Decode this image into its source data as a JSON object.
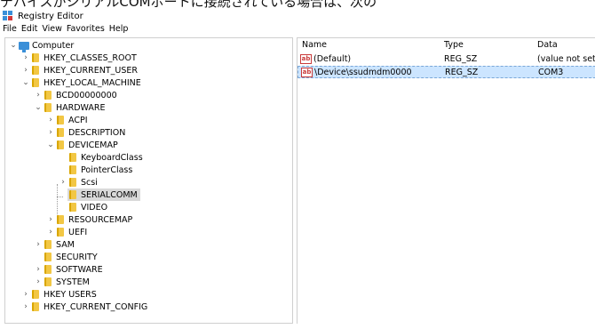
{
  "caption": "デバイスがシリアルCOMポートに接続されている場合は、次の",
  "window": {
    "title": "Registry Editor"
  },
  "menu": [
    "File",
    "Edit",
    "View",
    "Favorites",
    "Help"
  ],
  "tree": {
    "computer": "Computer",
    "hkcr": "HKEY_CLASSES_ROOT",
    "hkcu": "HKEY_CURRENT_USER",
    "hklm": "HKEY_LOCAL_MACHINE",
    "bcd": "BCD00000000",
    "hardware": "HARDWARE",
    "acpi": "ACPI",
    "description": "DESCRIPTION",
    "devicemap": "DEVICEMAP",
    "keyboardclass": "KeyboardClass",
    "pointerclass": "PointerClass",
    "scsi": "Scsi",
    "serialcomm": "SERIALCOMM",
    "video": "VIDEO",
    "resourcemap": "RESOURCEMAP",
    "uefi": "UEFI",
    "sam": "SAM",
    "security": "SECURITY",
    "software": "SOFTWARE",
    "system": "SYSTEM",
    "hku": "HKEY USERS",
    "hkcc": "HKEY_CURRENT_CONFIG"
  },
  "list": {
    "headers": {
      "name": "Name",
      "type": "Type",
      "data": "Data"
    },
    "rows": [
      {
        "name": "(Default)",
        "type": "REG_SZ",
        "data": "(value not set)",
        "icon": "ab"
      },
      {
        "name": "\\Device\\ssudmdm0000",
        "type": "REG_SZ",
        "data": "COM3",
        "icon": "ab"
      }
    ]
  }
}
